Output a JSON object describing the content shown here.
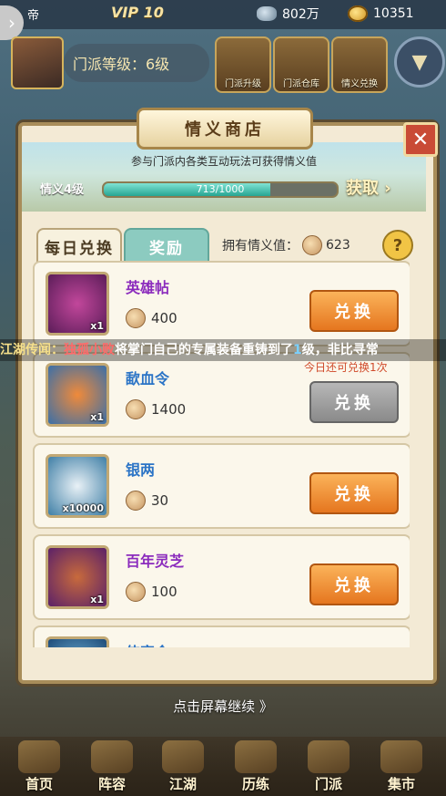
{
  "top_bar": {
    "left_text": "帝",
    "vip": "VIP 10",
    "silver": "802万",
    "gold": "10351"
  },
  "sect_header": {
    "level_label": "门派等级：6级",
    "icons": [
      {
        "label": "门派升级"
      },
      {
        "label": "门派仓库"
      },
      {
        "label": "情义兑换"
      }
    ]
  },
  "dialog": {
    "title": "情义商店",
    "banner_text": "参与门派内各类互动玩法可获得情义值",
    "level_label": "情义4级",
    "progress_text": "713/1000",
    "progress_fraction": 0.713,
    "get_label": "获取",
    "tabs": [
      {
        "label": "每日兑换",
        "active": true
      },
      {
        "label": "奖励",
        "active": false
      }
    ],
    "owned_label": "拥有情义值：",
    "owned_value": "623",
    "items": [
      {
        "name": "英雄帖",
        "qty": "x1",
        "price": "400",
        "button": "兑换",
        "enabled": true,
        "name_color": "#8b2bbd",
        "icon": "hero-invitation-icon"
      },
      {
        "name": "歃血令",
        "qty": "x1",
        "price": "1400",
        "button": "兑换",
        "enabled": false,
        "note": "今日还可兑换1次",
        "name_color": "#2b74c6",
        "icon": "blood-token-icon"
      },
      {
        "name": "银两",
        "qty": "x10000",
        "price": "30",
        "button": "兑换",
        "enabled": true,
        "name_color": "#2b74c6",
        "icon": "silver-ingot-icon"
      },
      {
        "name": "百年灵芝",
        "qty": "x1",
        "price": "100",
        "button": "兑换",
        "enabled": true,
        "name_color": "#8b2bbd",
        "icon": "lingzhi-mushroom-icon"
      },
      {
        "name": "侠客令",
        "qty": "",
        "price": "",
        "button": "",
        "enabled": true,
        "name_color": "#2b74c6",
        "icon": "partial-item-icon"
      }
    ]
  },
  "marquee": {
    "prefix": "江湖传闻：",
    "player": "独孤小败",
    "text1": "将掌门自己的专属装备重铸到了",
    "level": "1",
    "text2": "级，非比寻常"
  },
  "continue_hint": "点击屏幕继续 》",
  "bottom_nav": [
    {
      "label": "首页"
    },
    {
      "label": "阵容"
    },
    {
      "label": "江湖"
    },
    {
      "label": "历练"
    },
    {
      "label": "门派"
    },
    {
      "label": "集市"
    }
  ]
}
